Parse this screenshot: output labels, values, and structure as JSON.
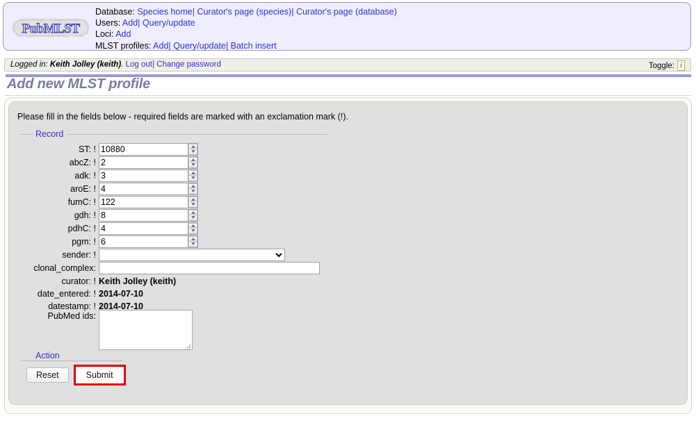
{
  "header": {
    "logo_text": "PubMLST",
    "nav": [
      {
        "label": "Database:",
        "links": [
          {
            "text": "Species home"
          },
          {
            "text": "Curator's page (species)"
          },
          {
            "text": "Curator's page (database)"
          }
        ]
      },
      {
        "label": "Users:",
        "links": [
          {
            "text": "Add"
          },
          {
            "text": "Query/update"
          }
        ]
      },
      {
        "label": "Loci:",
        "links": [
          {
            "text": "Add"
          }
        ]
      },
      {
        "label": "MLST profiles:",
        "links": [
          {
            "text": "Add"
          },
          {
            "text": "Query/update"
          },
          {
            "text": "Batch insert"
          }
        ]
      }
    ],
    "separator": "|"
  },
  "loginbar": {
    "prefix": "Logged in:",
    "user": "Keith Jolley (keith)",
    "suffix": ".",
    "logout_label": "Log out",
    "separator": "|",
    "change_password_label": "Change password",
    "toggle_label": "Toggle:",
    "toggle_icon": "i"
  },
  "page": {
    "title": "Add new MLST profile",
    "intro": "Please fill in the fields below - required fields are marked with an exclamation mark (!)."
  },
  "record": {
    "legend": "Record",
    "fields": [
      {
        "label": "ST:",
        "required": "!",
        "value": "10880",
        "type": "number"
      },
      {
        "label": "abcZ:",
        "required": "!",
        "value": "2",
        "type": "number"
      },
      {
        "label": "adk:",
        "required": "!",
        "value": "3",
        "type": "number"
      },
      {
        "label": "aroE:",
        "required": "!",
        "value": "4",
        "type": "number"
      },
      {
        "label": "fumC:",
        "required": "!",
        "value": "122",
        "type": "number"
      },
      {
        "label": "gdh:",
        "required": "!",
        "value": "8",
        "type": "number"
      },
      {
        "label": "pdhC:",
        "required": "!",
        "value": "4",
        "type": "number"
      },
      {
        "label": "pgm:",
        "required": "!",
        "value": "6",
        "type": "number"
      }
    ],
    "sender": {
      "label": "sender:",
      "required": "!",
      "value": "",
      "options": [
        ""
      ]
    },
    "clonal_complex": {
      "label": "clonal_complex:",
      "required": "",
      "value": "",
      "placeholder": ""
    },
    "curator": {
      "label": "curator:",
      "required": "!",
      "value": "Keith Jolley (keith)"
    },
    "date_entered": {
      "label": "date_entered:",
      "required": "!",
      "value": "2014-07-10"
    },
    "datestamp": {
      "label": "datestamp:",
      "required": "!",
      "value": "2014-07-10"
    },
    "pubmed_ids": {
      "label": "PubMed ids:",
      "required": "",
      "value": "",
      "placeholder": ""
    }
  },
  "action": {
    "legend": "Action",
    "reset_label": "Reset",
    "submit_label": "Submit",
    "highlight_color": "#e00000"
  },
  "colors": {
    "nav_bg": "#eeeeff",
    "link": "#3333cc",
    "title": "#7b7ba0",
    "title_rule": "#9999cc",
    "panel_bg": "#e0e0e0",
    "outer_panel_bg": "#fbfbf5",
    "legend": "#3333bb"
  }
}
